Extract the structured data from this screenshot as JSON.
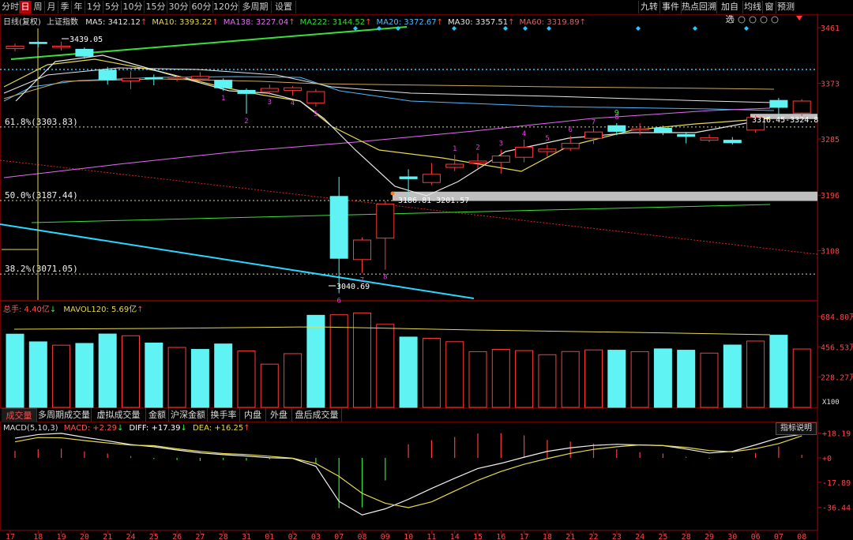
{
  "toolbar": {
    "left": [
      "分时",
      "日",
      "周",
      "月",
      "季",
      "年",
      "1分",
      "5分",
      "10分",
      "15分",
      "30分",
      "60分",
      "120分",
      "多周期",
      "设置"
    ],
    "active": "日",
    "right": [
      "九转",
      "事件",
      "热点回溯",
      "加自选",
      "均线",
      "窗",
      "预测"
    ]
  },
  "header": {
    "period": "日线(复权)",
    "index_name": "上证指数",
    "ma": [
      {
        "label": "MA5: 3412.12",
        "arrow": "↑",
        "color": "#e6e6e6"
      },
      {
        "label": "MA10: 3393.22",
        "arrow": "↑",
        "color": "#e6d94a"
      },
      {
        "label": "MA138: 3227.04",
        "arrow": "↑",
        "color": "#e36cf2"
      },
      {
        "label": "MA222: 3144.52",
        "arrow": "↑",
        "color": "#35d835"
      },
      {
        "label": "MA20: 3372.67",
        "arrow": "↑",
        "color": "#4fb8ff"
      },
      {
        "label": "MA30: 3357.51",
        "arrow": "↑",
        "color": "#e6e6e6"
      },
      {
        "label": "MA60: 3319.89",
        "arrow": "↑",
        "color": "#c86a6a"
      }
    ]
  },
  "price_axis": [
    "3461",
    "3373",
    "3285",
    "3196",
    "3108"
  ],
  "fib": [
    {
      "label": "61.8%(3303.83)",
      "value": 3303.83
    },
    {
      "label": "50.0%(3187.44)",
      "value": 3187.44
    },
    {
      "label": "38.2%(3071.05)",
      "value": 3071.05
    }
  ],
  "annotations": {
    "high": "3439.05",
    "low": "3040.69",
    "gap_low": "3186.81-3201.57",
    "gap_high": "3316.45-3324.8"
  },
  "volume_panel": {
    "title": "总手: 4.40亿",
    "title_arrow": "↓",
    "mavol": "MAVOL120: 5.69亿",
    "mavol_arrow": "↑",
    "axis": [
      "684.80万",
      "456.53万",
      "228.27万"
    ],
    "unit": "X100"
  },
  "bottom_tabs": [
    "成交量",
    "多周期成交量",
    "虚拟成交量",
    "金额",
    "沪深金额",
    "换手率",
    "内盘",
    "外盘",
    "盘后成交量"
  ],
  "macd_panel": {
    "label": "MACD(5,10,3)",
    "macd": "MACD: +2.29",
    "macd_arrow": "↓",
    "diff": "DIFF: +17.39",
    "diff_arrow": "↓",
    "dea": "DEA: +16.25",
    "dea_arrow": "↑",
    "button": "指标说明",
    "axis": [
      "+18.19",
      "+0",
      "-17.89",
      "-36.44"
    ]
  },
  "date_axis": [
    "17",
    "18",
    "19",
    "20",
    "21",
    "24",
    "25",
    "26",
    "27",
    "28",
    "31",
    "01",
    "02",
    "03",
    "07",
    "08",
    "09",
    "10",
    "11",
    "14",
    "15",
    "16",
    "17",
    "18",
    "21",
    "22",
    "23",
    "24",
    "25",
    "28",
    "29",
    "30",
    "06",
    "07",
    "08"
  ],
  "chart_data": {
    "type": "candlestick",
    "ylim": [
      3040,
      3470
    ],
    "candles": [
      {
        "d": "17",
        "o": 3428,
        "c": 3432,
        "h": 3436,
        "l": 3424,
        "up": true
      },
      {
        "d": "18",
        "o": 3436,
        "c": 3438,
        "h": 3440,
        "l": 3430,
        "up": false
      },
      {
        "d": "19",
        "o": 3432,
        "c": 3430,
        "h": 3439.05,
        "l": 3425,
        "up": true
      },
      {
        "d": "20",
        "o": 3427,
        "c": 3416,
        "h": 3430,
        "l": 3412,
        "up": false
      },
      {
        "d": "21",
        "o": 3394,
        "c": 3379,
        "h": 3399,
        "l": 3371,
        "up": false
      },
      {
        "d": "24",
        "o": 3377,
        "c": 3381,
        "h": 3392,
        "l": 3364,
        "up": true
      },
      {
        "d": "25",
        "o": 3380,
        "c": 3382,
        "h": 3387,
        "l": 3370,
        "up": false
      },
      {
        "d": "26",
        "o": 3381,
        "c": 3383,
        "h": 3385,
        "l": 3376,
        "up": true
      },
      {
        "d": "27",
        "o": 3384,
        "c": 3380,
        "h": 3391,
        "l": 3374,
        "up": true
      },
      {
        "d": "28",
        "o": 3378,
        "c": 3366,
        "h": 3381,
        "l": 3361,
        "up": false
      },
      {
        "d": "31",
        "o": 3362,
        "c": 3357,
        "h": 3365,
        "l": 3325,
        "up": false
      },
      {
        "d": "01",
        "o": 3360,
        "c": 3365,
        "h": 3371,
        "l": 3355,
        "up": true
      },
      {
        "d": "02",
        "o": 3362,
        "c": 3366,
        "h": 3369,
        "l": 3354,
        "up": true
      },
      {
        "d": "03",
        "o": 3360,
        "c": 3342,
        "h": 3364,
        "l": 3336,
        "up": true
      },
      {
        "d": "07",
        "o": 3194,
        "c": 3096,
        "h": 3225,
        "l": 3040.69,
        "up": false
      },
      {
        "d": "08",
        "o": 3125,
        "c": 3094,
        "h": 3129,
        "l": 3073,
        "up": true
      },
      {
        "d": "09",
        "o": 3128,
        "c": 3182,
        "h": 3187,
        "l": 3078,
        "up": true
      },
      {
        "d": "10",
        "o": 3222,
        "c": 3225,
        "h": 3237,
        "l": 3189,
        "up": false
      },
      {
        "d": "11",
        "o": 3216,
        "c": 3229,
        "h": 3247,
        "l": 3212,
        "up": true
      },
      {
        "d": "14",
        "o": 3240,
        "c": 3245,
        "h": 3260,
        "l": 3234,
        "up": true
      },
      {
        "d": "15",
        "o": 3247,
        "c": 3250,
        "h": 3262,
        "l": 3238,
        "up": true
      },
      {
        "d": "16",
        "o": 3248,
        "c": 3258,
        "h": 3268,
        "l": 3230,
        "up": true
      },
      {
        "d": "17",
        "o": 3256,
        "c": 3272,
        "h": 3284,
        "l": 3248,
        "up": true
      },
      {
        "d": "18",
        "o": 3265,
        "c": 3269,
        "h": 3276,
        "l": 3257,
        "up": true
      },
      {
        "d": "21",
        "o": 3270,
        "c": 3278,
        "h": 3290,
        "l": 3266,
        "up": true
      },
      {
        "d": "22",
        "o": 3286,
        "c": 3296,
        "h": 3302,
        "l": 3277,
        "up": true
      },
      {
        "d": "23",
        "o": 3306,
        "c": 3297,
        "h": 3310,
        "l": 3291,
        "up": false
      },
      {
        "d": "24",
        "o": 3299,
        "c": 3301,
        "h": 3310,
        "l": 3291,
        "up": true
      },
      {
        "d": "25",
        "o": 3302,
        "c": 3296,
        "h": 3306,
        "l": 3291,
        "up": false
      },
      {
        "d": "28",
        "o": 3292,
        "c": 3289,
        "h": 3296,
        "l": 3278,
        "up": false
      },
      {
        "d": "29",
        "o": 3283,
        "c": 3287,
        "h": 3292,
        "l": 3280,
        "up": true
      },
      {
        "d": "30",
        "o": 3283,
        "c": 3279,
        "h": 3288,
        "l": 3276,
        "up": false
      },
      {
        "d": "06",
        "o": 3299,
        "c": 3319,
        "h": 3322,
        "l": 3295,
        "up": true
      },
      {
        "d": "07",
        "o": 3346,
        "c": 3335,
        "h": 3350,
        "l": 3316,
        "up": false
      },
      {
        "d": "08",
        "o": 3326,
        "c": 3345,
        "h": 3348,
        "l": 3321,
        "up": true
      }
    ],
    "volume": [
      0.552,
      0.494,
      0.469,
      0.482,
      0.553,
      0.54,
      0.485,
      0.452,
      0.437,
      0.478,
      0.425,
      0.326,
      0.405,
      0.694,
      0.698,
      0.712,
      0.626,
      0.53,
      0.521,
      0.495,
      0.42,
      0.437,
      0.428,
      0.397,
      0.421,
      0.433,
      0.431,
      0.42,
      0.441,
      0.431,
      0.409,
      0.47,
      0.5,
      0.544,
      0.44
    ],
    "volume_up": [
      false,
      false,
      true,
      false,
      false,
      true,
      false,
      true,
      false,
      false,
      true,
      true,
      true,
      false,
      true,
      true,
      true,
      false,
      true,
      true,
      true,
      true,
      true,
      true,
      true,
      true,
      false,
      true,
      false,
      false,
      true,
      false,
      true,
      false,
      true
    ],
    "macd_hist": [
      5.2,
      6.4,
      6.8,
      4.8,
      3.2,
      1.4,
      -0.8,
      -1.6,
      -2.2,
      -1.6,
      -2.0,
      -1.0,
      -0.4,
      -4.2,
      -37.0,
      -36.4,
      -16.6,
      10.0,
      13.0,
      15.4,
      18.0,
      18.2,
      16.6,
      13.2,
      12.0,
      10.6,
      6.4,
      4.2,
      3.2,
      0.8,
      -0.4,
      0.8,
      3.6,
      8.4,
      2.29
    ],
    "diff": [
      14.5,
      17.2,
      18.1,
      15.2,
      12.6,
      9.8,
      8.2,
      5.8,
      3.7,
      2.4,
      1.4,
      0.1,
      -0.4,
      -6.2,
      -32.0,
      -42.0,
      -37.5,
      -30.5,
      -22.5,
      -15.0,
      -7.8,
      -4.0,
      0.5,
      4.8,
      7.4,
      9.2,
      10.0,
      9.5,
      9.1,
      6.5,
      3.6,
      4.8,
      9.6,
      14.8,
      17.39
    ],
    "dea": [
      11.8,
      15.0,
      14.8,
      12.8,
      11.0,
      9.4,
      9.0,
      6.7,
      4.8,
      3.2,
      2.5,
      1.2,
      -0.2,
      -4.1,
      -13.6,
      -26.1,
      -33.4,
      -36.6,
      -32.4,
      -24.4,
      -16.5,
      -10.0,
      -4.7,
      -0.5,
      3.3,
      6.3,
      8.2,
      9.6,
      9.1,
      7.7,
      5.4,
      4.5,
      6.8,
      10.5,
      16.25
    ]
  }
}
